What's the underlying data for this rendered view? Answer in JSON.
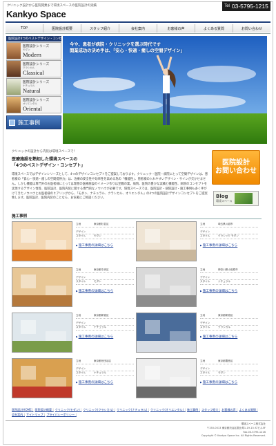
{
  "header": {
    "tagline": "クリニック設計から医院開業まで環境スペースの医院設計の実績",
    "logo": "Kankyo Space",
    "tel_label": "Tel",
    "tel": "03-5795-1215"
  },
  "nav": [
    "TOP",
    "医院設計概要",
    "スタッフ紹介",
    "会社案内",
    "お客様の声",
    "よくある質問",
    "お問い合わせ"
  ],
  "sidebar": {
    "title": "医院設計4つのベストデザイン・コンセプト",
    "series": [
      {
        "label": "医院設計シリーズ",
        "kana": "モダン",
        "name": "Modern",
        "color": "#b57a45"
      },
      {
        "label": "医院設計シリーズ",
        "kana": "クラシカル",
        "name": "Classical",
        "color": "#8c5a35"
      },
      {
        "label": "医院設計シリーズ",
        "kana": "ナチュラル",
        "name": "Natural",
        "color": "#a8b27e"
      },
      {
        "label": "医院設計シリーズ",
        "kana": "オリエンタル",
        "name": "Oriental",
        "color": "#c08a4a"
      }
    ],
    "case_button": "施工事例"
  },
  "hero": {
    "line1": "今や、患者が病院・クリニックを選ぶ時代です",
    "line2": "開業成功の決め手は、「安心・快適・癒しの空間デザイン」"
  },
  "intro": {
    "breadcrumb": "クリニックの設計から内装は環境スペースで！",
    "heading1": "医療施設を熟知した環境スペースの",
    "heading2": "「4つのベストデザイン・コンセプト」",
    "body": "環境スペースではデザインシリーズとして、4つのデザインコンセプトをご提案しております。クリニック・医院・病院にとって空間デザインは、患者様の「安心・快適・癒しの空間提供力」は、治療の安全性や効率性を高める為の「機能性」、患者様の入れやすいデザイン・サインが欠かせません。しかし機能は専門外のお医者様にとっては理想の医療施設のイメージ作りは至難の業。病院、医院の豊かな実績と機能性、病院のコンセプトを実現するデザイン性等、医院設計、医院内装に関する専門的なノウハウが必要です。環境スペースでは、医院設計・病院設計・施工事例も多く手がけてきたノウハウとお医者様のヒアリングから、「モダン、ナチュラル、クラシカル、オリエンタル」の4つの医院設計デザインコンセプトをご提案致します。医院設計、医院内装のことなら、お気軽にご相談ください。"
  },
  "consult": {
    "line1": "医院設計",
    "line2": "お問い合わせ"
  },
  "blog": {
    "title": "Blog",
    "sub": "環境スペース"
  },
  "cases_heading": "施工事例",
  "cases": [
    {
      "place": "東京都杉並区",
      "style": "モダン",
      "link": "施工事例の詳細はこちら",
      "wall": "#f3d7b3",
      "floor": "#e07820"
    },
    {
      "place": "埼玉県川越市",
      "style": "クラシック モダン",
      "link": "施工事例の詳細はこちら",
      "wall": "#efe4d4",
      "floor": "#c9b79c"
    },
    {
      "place": "東京都中央区",
      "style": "モダン",
      "link": "施工事例の詳細はこちら",
      "wall": "#e8c796",
      "floor": "#b5793c"
    },
    {
      "place": "神奈川県小田原市",
      "style": "ナチュラル",
      "link": "施工事例の詳細はこちら",
      "wall": "#d9d9d9",
      "floor": "#8c8c8c"
    },
    {
      "place": "東京都新宿区",
      "style": "ナチュラル",
      "link": "施工事例の詳細はこちら",
      "wall": "#dfe7ec",
      "floor": "#7a9c4a"
    },
    {
      "place": "東京都新宿区",
      "style": "クラシカル",
      "link": "施工事例の詳細はこちら",
      "wall": "#4a6c9a",
      "floor": "#d8dde4"
    },
    {
      "place": "東京都世田谷区",
      "style": "ナチュラル",
      "link": "施工事例の詳細はこちら",
      "wall": "#d9a050",
      "floor": "#c0392b"
    },
    {
      "place": "東京都豊島区",
      "style": "モダン",
      "link": "施工事例の詳細はこちら",
      "wall": "#eeeeee",
      "floor": "#6b6b6b"
    }
  ],
  "case_labels": {
    "location": "立地",
    "design": "デザイン",
    "style": "スタイル"
  },
  "footer_links": [
    "医院設計HOME",
    "医院設計概要",
    "クリニック(モダン)",
    "クリニック(クラシカル)",
    "クリニック(ナチュラル)",
    "クリニック(オリエンタル)",
    "施工事例",
    "スタッフ紹介",
    "お客様の声",
    "よくある質問",
    "会社案内",
    "サイトマップ",
    "プライバシーポリシー"
  ],
  "footer_info": {
    "company": "環境スペース株式会社",
    "address": "〒150-0013 東京都渋谷区恵比寿1-19-15 ATビル5F",
    "fax": "Fax.03-5795-1216",
    "copyright": "Copyright © Kankyo Space Inc. All Rights Reserved."
  }
}
